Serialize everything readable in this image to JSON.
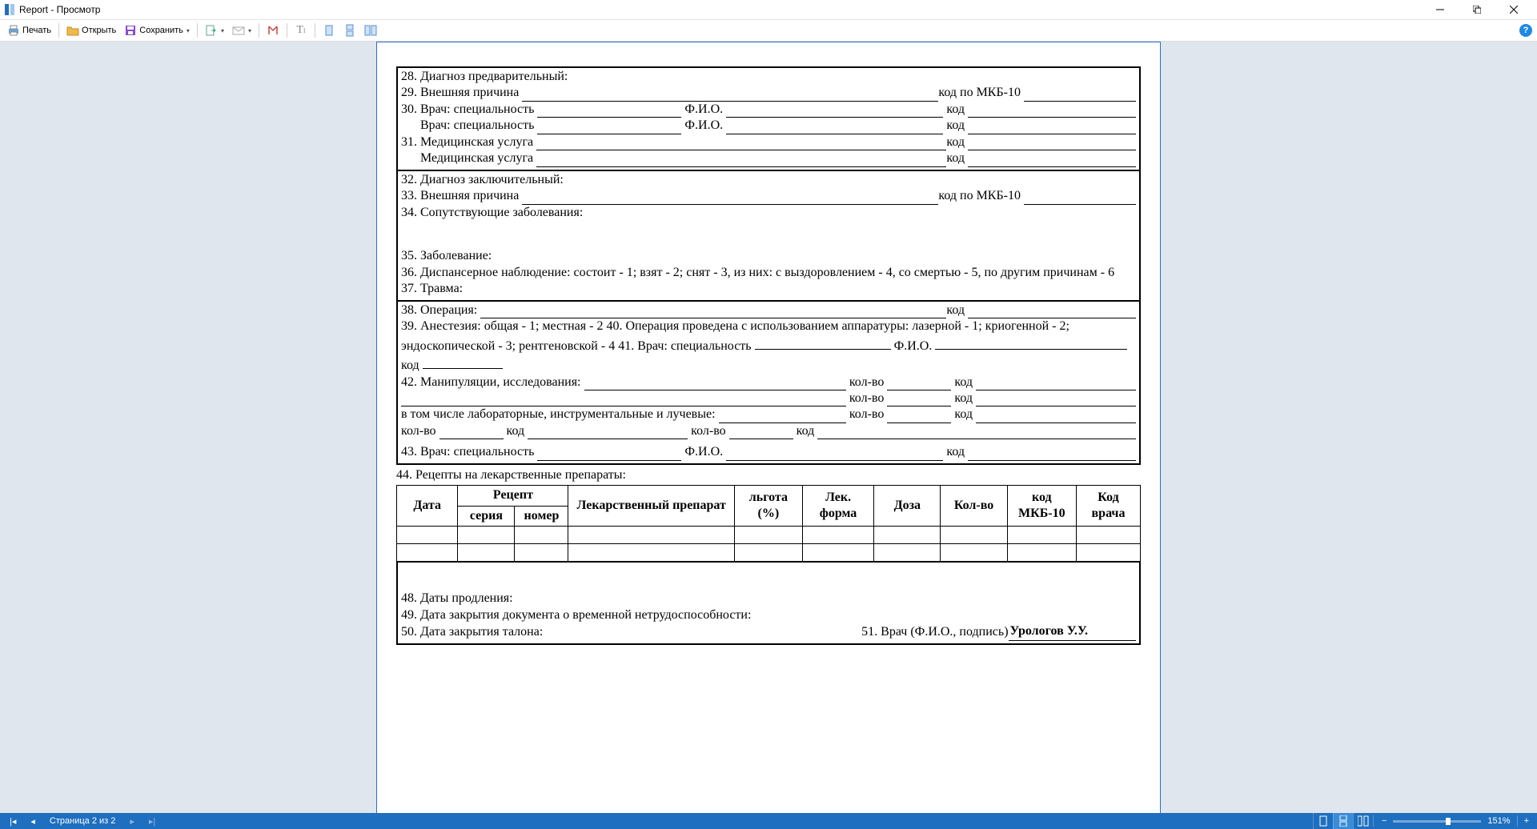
{
  "window": {
    "title": "Report - Просмотр"
  },
  "toolbar": {
    "print": "Печать",
    "open": "Открыть",
    "save": "Сохранить"
  },
  "doc": {
    "l28": "28. Диагноз предварительный:",
    "l29a": "29.  Внешняя причина",
    "l29b": "код по МКБ-10",
    "l30a": "30. Врач: специальность",
    "fio": "Ф.И.О.",
    "kod": "код",
    "l30r2": "Врач: специальность",
    "l31a": "31.  Медицинская услуга",
    "l31r2": "Медицинская услуга",
    "l32": "32. Диагноз заключительный:",
    "l33a": "33.  Внешняя причина",
    "l34": "34. Сопутствующие заболевания:",
    "l35": "35. Заболевание:",
    "l36": "36. Диспансерное наблюдение: состоит - 1; взят - 2; снят - 3, из них: с выздоровлением - 4, со смертью - 5, по другим причинам - 6",
    "l37": "37. Травма:",
    "l38a": "38.  Операция:",
    "l39": "39. Анестезия: общая - 1; местная - 2 40. Операция проведена с использованием аппаратуры: лазерной - 1; криогенной - 2; эндоскопической - 3; рентгеновской - 4 41. Врач: специальность",
    "l42a": "42. Манипуляции, исследования:",
    "kolvo": "кол-во",
    "l_incl": "в том числе лабораторные, инструментальные и лучевые:",
    "l43a": "43. Врач: специальность",
    "l44": "44. Рецепты на лекарственные препараты:",
    "th_date": "Дата",
    "th_recipe": "Рецепт",
    "th_series": "серия",
    "th_number": "номер",
    "th_drug": "Лекарственный препарат",
    "th_benefit": "льгота (%)",
    "th_form": "Лек. форма",
    "th_dose": "Доза",
    "th_qty": "Кол-во",
    "th_mkb": "код МКБ-10",
    "th_doccode": "Код врача",
    "l48": "48. Даты продления:",
    "l49": "49. Дата закрытия документа о временной нетрудоспособности:",
    "l50": "50. Дата закрытия талона:",
    "l51a": "51. Врач (Ф.И.О., подпись) ",
    "l51b": "Урологов У.У."
  },
  "status": {
    "page": "Страница 2 из 2",
    "zoom": "151%"
  }
}
